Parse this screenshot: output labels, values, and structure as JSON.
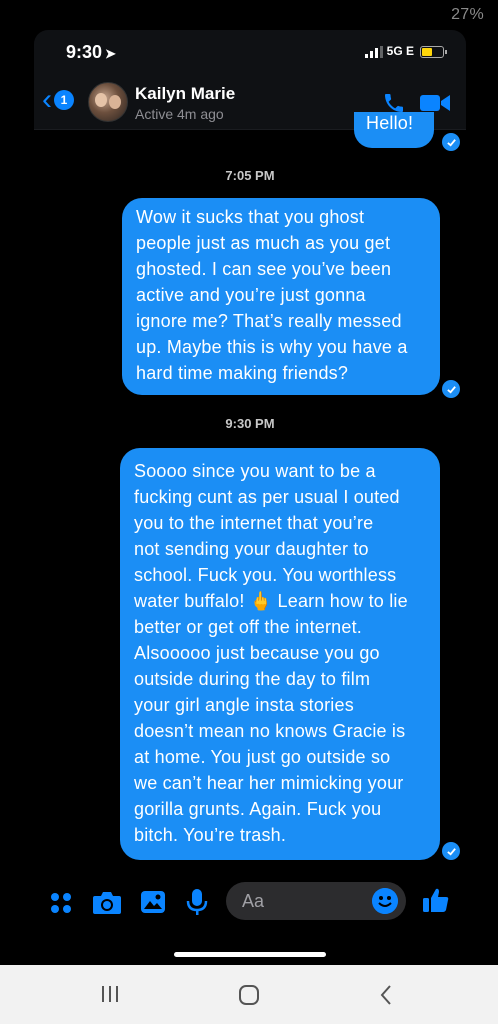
{
  "device": {
    "battery_percent": "27%"
  },
  "status": {
    "time": "9:30",
    "network": "5G E",
    "battery_level": 0.55
  },
  "header": {
    "back_count": "1",
    "contact_name": "Kailyn Marie",
    "active_status": "Active 4m ago"
  },
  "messages": [
    {
      "type": "sent",
      "text": "Hello!",
      "partial": true
    },
    {
      "type": "timestamp",
      "text": "7:05 PM"
    },
    {
      "type": "sent",
      "lines": [
        "Wow it sucks that you ghost",
        "people just as much as you get",
        "ghosted. I can see you’ve been",
        "active and you’re just gonna",
        "ignore me? That’s really messed",
        "up. Maybe this is why you have a",
        "hard time making friends?"
      ]
    },
    {
      "type": "timestamp",
      "text": "9:30 PM"
    },
    {
      "type": "sent",
      "lines": [
        "Soooo since you want to be a",
        "fucking cunt as per usual I outed",
        "you to the internet that you’re",
        "not sending your daughter to",
        "school. Fuck you. You worthless",
        "water buffalo! 🖕 Learn how to lie",
        "better or get off the internet.",
        "Alsooooo just because you go",
        "outside during the day to film",
        "your girl angle insta stories",
        "doesn’t mean no knows Gracie is",
        "at home. You just go outside so",
        "we can’t hear her mimicking your",
        "gorilla grunts. Again. Fuck you",
        "bitch. You’re trash."
      ]
    }
  ],
  "composer": {
    "placeholder": "Aa"
  },
  "icons": [
    "back-chevron-icon",
    "phone-icon",
    "video-camera-icon",
    "apps-menu-icon",
    "camera-icon",
    "image-icon",
    "microphone-icon",
    "emoji-icon",
    "thumbs-up-icon",
    "recent-apps-icon",
    "home-icon",
    "back-icon",
    "read-receipt-icon"
  ],
  "colors": {
    "bubble": "#1b8ef5",
    "accent": "#0a84ff",
    "background": "#000000"
  }
}
